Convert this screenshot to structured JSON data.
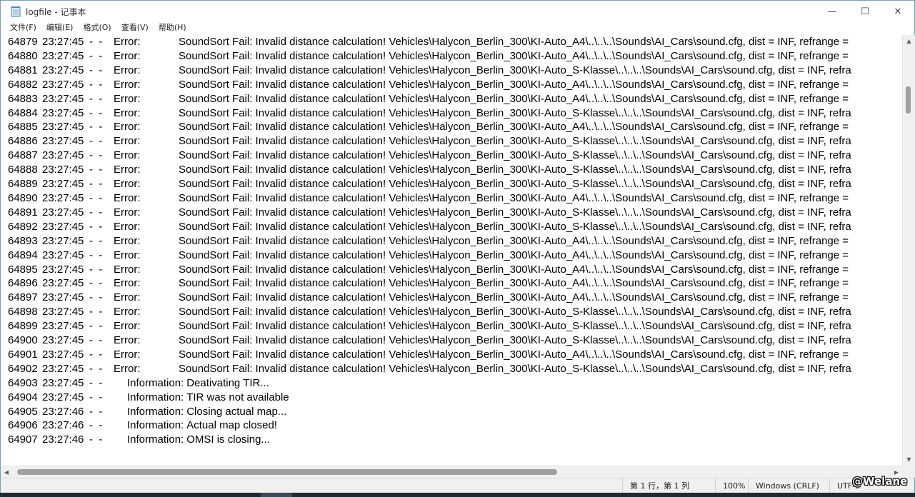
{
  "window": {
    "title": "logfile - 记事本",
    "icon": "notepad-icon",
    "controls": {
      "minimize": "—",
      "maximize": "☐",
      "close": "✕"
    }
  },
  "menu": [
    "文件(F)",
    "编辑(E)",
    "格式(O)",
    "查看(V)",
    "帮助(H)"
  ],
  "log_lines": [
    {
      "num": "64879",
      "time": "23:27:45",
      "sep": "-  -",
      "level": "Error:",
      "msg": "SoundSort Fail: Invalid distance calculation! Vehicles\\Halycon_Berlin_300\\KI-Auto_A4\\..\\..\\..\\Sounds\\AI_Cars\\sound.cfg, dist = INF, refrange ="
    },
    {
      "num": "64880",
      "time": "23:27:45",
      "sep": "-  -",
      "level": "Error:",
      "msg": "SoundSort Fail: Invalid distance calculation! Vehicles\\Halycon_Berlin_300\\KI-Auto_A4\\..\\..\\..\\Sounds\\AI_Cars\\sound.cfg, dist = INF, refrange ="
    },
    {
      "num": "64881",
      "time": "23:27:45",
      "sep": "-  -",
      "level": "Error:",
      "msg": "SoundSort Fail: Invalid distance calculation! Vehicles\\Halycon_Berlin_300\\KI-Auto_S-Klasse\\..\\..\\..\\Sounds\\AI_Cars\\sound.cfg, dist = INF, refra"
    },
    {
      "num": "64882",
      "time": "23:27:45",
      "sep": "-  -",
      "level": "Error:",
      "msg": "SoundSort Fail: Invalid distance calculation! Vehicles\\Halycon_Berlin_300\\KI-Auto_A4\\..\\..\\..\\Sounds\\AI_Cars\\sound.cfg, dist = INF, refrange ="
    },
    {
      "num": "64883",
      "time": "23:27:45",
      "sep": "-  -",
      "level": "Error:",
      "msg": "SoundSort Fail: Invalid distance calculation! Vehicles\\Halycon_Berlin_300\\KI-Auto_A4\\..\\..\\..\\Sounds\\AI_Cars\\sound.cfg, dist = INF, refrange ="
    },
    {
      "num": "64884",
      "time": "23:27:45",
      "sep": "-  -",
      "level": "Error:",
      "msg": "SoundSort Fail: Invalid distance calculation! Vehicles\\Halycon_Berlin_300\\KI-Auto_S-Klasse\\..\\..\\..\\Sounds\\AI_Cars\\sound.cfg, dist = INF, refra"
    },
    {
      "num": "64885",
      "time": "23:27:45",
      "sep": "-  -",
      "level": "Error:",
      "msg": "SoundSort Fail: Invalid distance calculation! Vehicles\\Halycon_Berlin_300\\KI-Auto_A4\\..\\..\\..\\Sounds\\AI_Cars\\sound.cfg, dist = INF, refrange ="
    },
    {
      "num": "64886",
      "time": "23:27:45",
      "sep": "-  -",
      "level": "Error:",
      "msg": "SoundSort Fail: Invalid distance calculation! Vehicles\\Halycon_Berlin_300\\KI-Auto_S-Klasse\\..\\..\\..\\Sounds\\AI_Cars\\sound.cfg, dist = INF, refra"
    },
    {
      "num": "64887",
      "time": "23:27:45",
      "sep": "-  -",
      "level": "Error:",
      "msg": "SoundSort Fail: Invalid distance calculation! Vehicles\\Halycon_Berlin_300\\KI-Auto_S-Klasse\\..\\..\\..\\Sounds\\AI_Cars\\sound.cfg, dist = INF, refra"
    },
    {
      "num": "64888",
      "time": "23:27:45",
      "sep": "-  -",
      "level": "Error:",
      "msg": "SoundSort Fail: Invalid distance calculation! Vehicles\\Halycon_Berlin_300\\KI-Auto_S-Klasse\\..\\..\\..\\Sounds\\AI_Cars\\sound.cfg, dist = INF, refra"
    },
    {
      "num": "64889",
      "time": "23:27:45",
      "sep": "-  -",
      "level": "Error:",
      "msg": "SoundSort Fail: Invalid distance calculation! Vehicles\\Halycon_Berlin_300\\KI-Auto_S-Klasse\\..\\..\\..\\Sounds\\AI_Cars\\sound.cfg, dist = INF, refra"
    },
    {
      "num": "64890",
      "time": "23:27:45",
      "sep": "-  -",
      "level": "Error:",
      "msg": "SoundSort Fail: Invalid distance calculation! Vehicles\\Halycon_Berlin_300\\KI-Auto_A4\\..\\..\\..\\Sounds\\AI_Cars\\sound.cfg, dist = INF, refrange ="
    },
    {
      "num": "64891",
      "time": "23:27:45",
      "sep": "-  -",
      "level": "Error:",
      "msg": "SoundSort Fail: Invalid distance calculation! Vehicles\\Halycon_Berlin_300\\KI-Auto_S-Klasse\\..\\..\\..\\Sounds\\AI_Cars\\sound.cfg, dist = INF, refra"
    },
    {
      "num": "64892",
      "time": "23:27:45",
      "sep": "-  -",
      "level": "Error:",
      "msg": "SoundSort Fail: Invalid distance calculation! Vehicles\\Halycon_Berlin_300\\KI-Auto_S-Klasse\\..\\..\\..\\Sounds\\AI_Cars\\sound.cfg, dist = INF, refra"
    },
    {
      "num": "64893",
      "time": "23:27:45",
      "sep": "-  -",
      "level": "Error:",
      "msg": "SoundSort Fail: Invalid distance calculation! Vehicles\\Halycon_Berlin_300\\KI-Auto_A4\\..\\..\\..\\Sounds\\AI_Cars\\sound.cfg, dist = INF, refrange ="
    },
    {
      "num": "64894",
      "time": "23:27:45",
      "sep": "-  -",
      "level": "Error:",
      "msg": "SoundSort Fail: Invalid distance calculation! Vehicles\\Halycon_Berlin_300\\KI-Auto_A4\\..\\..\\..\\Sounds\\AI_Cars\\sound.cfg, dist = INF, refrange ="
    },
    {
      "num": "64895",
      "time": "23:27:45",
      "sep": "-  -",
      "level": "Error:",
      "msg": "SoundSort Fail: Invalid distance calculation! Vehicles\\Halycon_Berlin_300\\KI-Auto_A4\\..\\..\\..\\Sounds\\AI_Cars\\sound.cfg, dist = INF, refrange ="
    },
    {
      "num": "64896",
      "time": "23:27:45",
      "sep": "-  -",
      "level": "Error:",
      "msg": "SoundSort Fail: Invalid distance calculation! Vehicles\\Halycon_Berlin_300\\KI-Auto_A4\\..\\..\\..\\Sounds\\AI_Cars\\sound.cfg, dist = INF, refrange ="
    },
    {
      "num": "64897",
      "time": "23:27:45",
      "sep": "-  -",
      "level": "Error:",
      "msg": "SoundSort Fail: Invalid distance calculation! Vehicles\\Halycon_Berlin_300\\KI-Auto_A4\\..\\..\\..\\Sounds\\AI_Cars\\sound.cfg, dist = INF, refrange ="
    },
    {
      "num": "64898",
      "time": "23:27:45",
      "sep": "-  -",
      "level": "Error:",
      "msg": "SoundSort Fail: Invalid distance calculation! Vehicles\\Halycon_Berlin_300\\KI-Auto_S-Klasse\\..\\..\\..\\Sounds\\AI_Cars\\sound.cfg, dist = INF, refra"
    },
    {
      "num": "64899",
      "time": "23:27:45",
      "sep": "-  -",
      "level": "Error:",
      "msg": "SoundSort Fail: Invalid distance calculation! Vehicles\\Halycon_Berlin_300\\KI-Auto_S-Klasse\\..\\..\\..\\Sounds\\AI_Cars\\sound.cfg, dist = INF, refra"
    },
    {
      "num": "64900",
      "time": "23:27:45",
      "sep": "-  -",
      "level": "Error:",
      "msg": "SoundSort Fail: Invalid distance calculation! Vehicles\\Halycon_Berlin_300\\KI-Auto_S-Klasse\\..\\..\\..\\Sounds\\AI_Cars\\sound.cfg, dist = INF, refra"
    },
    {
      "num": "64901",
      "time": "23:27:45",
      "sep": "-  -",
      "level": "Error:",
      "msg": "SoundSort Fail: Invalid distance calculation! Vehicles\\Halycon_Berlin_300\\KI-Auto_A4\\..\\..\\..\\Sounds\\AI_Cars\\sound.cfg, dist = INF, refrange ="
    },
    {
      "num": "64902",
      "time": "23:27:45",
      "sep": "-  -",
      "level": "Error:",
      "msg": "SoundSort Fail: Invalid distance calculation! Vehicles\\Halycon_Berlin_300\\KI-Auto_S-Klasse\\..\\..\\..\\Sounds\\AI_Cars\\sound.cfg, dist = INF, refra"
    },
    {
      "num": "64903",
      "time": "23:27:45",
      "sep": "-  -",
      "level": "Information:",
      "msg": "Deativating TIR..."
    },
    {
      "num": "64904",
      "time": "23:27:45",
      "sep": "-  -",
      "level": "Information:",
      "msg": "TIR was not available"
    },
    {
      "num": "64905",
      "time": "23:27:46",
      "sep": "-  -",
      "level": "Information:",
      "msg": "Closing actual map..."
    },
    {
      "num": "64906",
      "time": "23:27:46",
      "sep": "-  -",
      "level": "Information:",
      "msg": "Actual map closed!"
    },
    {
      "num": "64907",
      "time": "23:27:46",
      "sep": "-  -",
      "level": "Information:",
      "msg": "OMSI is closing..."
    }
  ],
  "status": {
    "position": "第 1 行，第 1 列",
    "zoom": "100%",
    "line_ending": "Windows (CRLF)",
    "encoding": "UTF-8"
  },
  "watermark": "@Welane",
  "colors": {
    "scroll_thumb": "#a0a0a0",
    "chrome": "#f0f0f0",
    "taskbar": "#1f2a33"
  }
}
